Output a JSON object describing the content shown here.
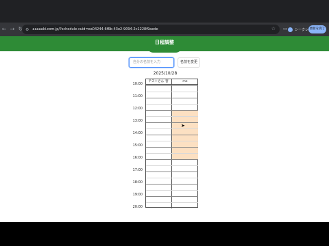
{
  "browser": {
    "url": "aaaaaki.com.jp/?schedule-cuid=ea04244-6f6b-43e2-9094-2c1228f9aede",
    "profile_label": "シークレット",
    "update_button": "更新を完了"
  },
  "app": {
    "title": "日程調整"
  },
  "form": {
    "name_placeholder": "自分の名前を入力",
    "rename_button": "名前を変更"
  },
  "schedule": {
    "date": "2025/10/28",
    "columns": [
      "テストさん",
      "me"
    ],
    "column_icon": "trash-icon",
    "times": [
      "10:00",
      "11:00",
      "12:00",
      "13:00",
      "14:00",
      "15:00",
      "16:00",
      "17:00",
      "18:00",
      "19:00",
      "20:00"
    ],
    "selected_slots": {
      "me": [
        "12:00",
        "12:30",
        "13:00",
        "13:30",
        "14:00",
        "14:30",
        "15:00",
        "15:30"
      ]
    },
    "selection_color": "#fce0c2"
  },
  "colors": {
    "accent": "#2e8b36"
  }
}
